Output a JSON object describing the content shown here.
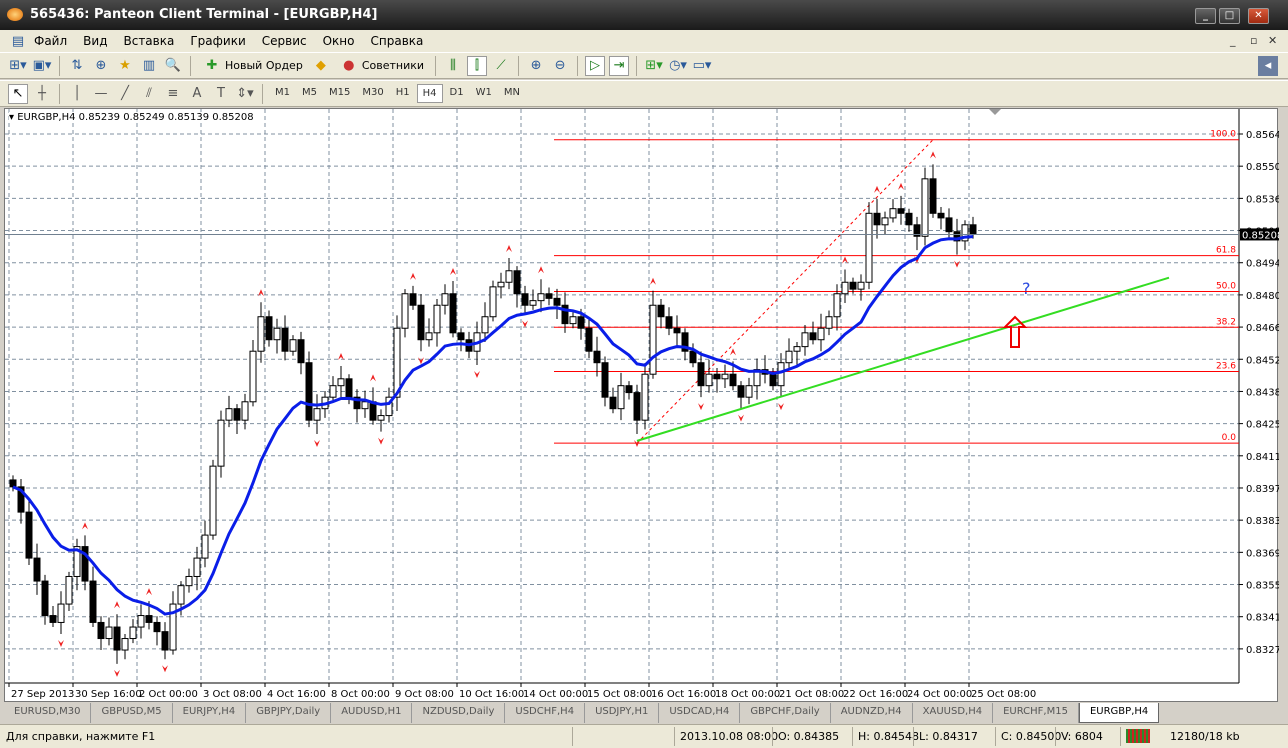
{
  "window": {
    "title": "565436: Panteon Client Terminal - [EURGBP,H4]"
  },
  "menu": [
    "Файл",
    "Вид",
    "Вставка",
    "Графики",
    "Сервис",
    "Окно",
    "Справка"
  ],
  "toolbar": {
    "new_order": "Новый Ордер",
    "experts": "Советники"
  },
  "timeframes": [
    "M1",
    "M5",
    "M15",
    "M30",
    "H1",
    "H4",
    "D1",
    "W1",
    "MN"
  ],
  "active_timeframe": "H4",
  "chart": {
    "header": "EURGBP,H4  0.85239 0.85249 0.85139 0.85208",
    "current_price": "0.85208",
    "question_mark": "?"
  },
  "chart_data": {
    "type": "candlestick",
    "symbol": "EURGBP",
    "period": "H4",
    "ylim": [
      0.8327,
      0.8571
    ],
    "price_ticks": [
      "0.85645",
      "0.85505",
      "0.85365",
      "0.85085",
      "0.84945",
      "0.84805",
      "0.84665",
      "0.84525",
      "0.84385",
      "0.84250",
      "0.84110",
      "0.83970",
      "0.83830",
      "0.83690",
      "0.83550",
      "0.83410",
      "0.83270"
    ],
    "date_labels": [
      "27 Sep 2013",
      "30 Sep 16:00",
      "2 Oct 00:00",
      "3 Oct 08:00",
      "4 Oct 16:00",
      "8 Oct 00:00",
      "9 Oct 08:00",
      "10 Oct 16:00",
      "14 Oct 00:00",
      "15 Oct 08:00",
      "16 Oct 16:00",
      "18 Oct 00:00",
      "21 Oct 08:00",
      "22 Oct 16:00",
      "24 Oct 00:00",
      "25 Oct 08:00"
    ],
    "closes": [
      0.8411,
      0.84,
      0.838,
      0.837,
      0.8355,
      0.8352,
      0.836,
      0.8372,
      0.8385,
      0.837,
      0.8352,
      0.8345,
      0.835,
      0.834,
      0.8345,
      0.835,
      0.8355,
      0.8352,
      0.8348,
      0.834,
      0.836,
      0.8368,
      0.8372,
      0.838,
      0.839,
      0.842,
      0.844,
      0.8445,
      0.844,
      0.8448,
      0.847,
      0.8485,
      0.8475,
      0.848,
      0.847,
      0.8475,
      0.8465,
      0.844,
      0.8445,
      0.845,
      0.8455,
      0.8458,
      0.845,
      0.8445,
      0.8448,
      0.844,
      0.8442,
      0.845,
      0.848,
      0.8495,
      0.849,
      0.8475,
      0.8478,
      0.849,
      0.8495,
      0.8478,
      0.8475,
      0.847,
      0.8478,
      0.8485,
      0.8498,
      0.85,
      0.8505,
      0.8495,
      0.849,
      0.8492,
      0.8495,
      0.8493,
      0.849,
      0.8482,
      0.8485,
      0.848,
      0.847,
      0.8465,
      0.845,
      0.8445,
      0.8455,
      0.8452,
      0.844,
      0.846,
      0.849,
      0.8485,
      0.848,
      0.8478,
      0.847,
      0.8465,
      0.8455,
      0.846,
      0.8458,
      0.846,
      0.8455,
      0.845,
      0.8455,
      0.8462,
      0.846,
      0.8455,
      0.8465,
      0.847,
      0.8472,
      0.8478,
      0.8475,
      0.848,
      0.8485,
      0.8495,
      0.85,
      0.8497,
      0.85,
      0.853,
      0.8525,
      0.8528,
      0.8532,
      0.853,
      0.8525,
      0.852,
      0.8545,
      0.853,
      0.8528,
      0.8522,
      0.8518,
      0.8525,
      0.8521
    ],
    "ma_period": 14,
    "fibonacci": {
      "from": {
        "index": 78,
        "price": 0.843
      },
      "to": {
        "index": 115,
        "price": 0.8562
      },
      "levels": [
        "0.0",
        "23.6",
        "38.2",
        "50.0",
        "61.8",
        "100.0"
      ]
    },
    "trendline": {
      "from": {
        "index": 78,
        "price": 0.8431
      },
      "to": {
        "index": 144.5,
        "price": 0.8502
      }
    },
    "colors": {
      "ma": "#0a1ee8",
      "trend": "#33dd22",
      "fib": "#ff0000",
      "fractal": "#ee2222"
    }
  },
  "tabs": [
    "EURUSD,M30",
    "GBPUSD,M5",
    "EURJPY,H4",
    "GBPJPY,Daily",
    "AUDUSD,H1",
    "NZDUSD,Daily",
    "USDCHF,H4",
    "USDJPY,H1",
    "USDCAD,H4",
    "GBPCHF,Daily",
    "AUDNZD,H4",
    "XAUUSD,H4",
    "EURCHF,M15",
    "EURGBP,H4"
  ],
  "active_tab": "EURGBP,H4",
  "status": {
    "help": "Для справки, нажмите F1",
    "datetime": "2013.10.08 08:00",
    "open": "O: 0.84385",
    "high": "H: 0.84548",
    "low": "L: 0.84317",
    "close": "C: 0.84500",
    "volume": "V: 6804",
    "traffic": "12180/18 kb"
  }
}
